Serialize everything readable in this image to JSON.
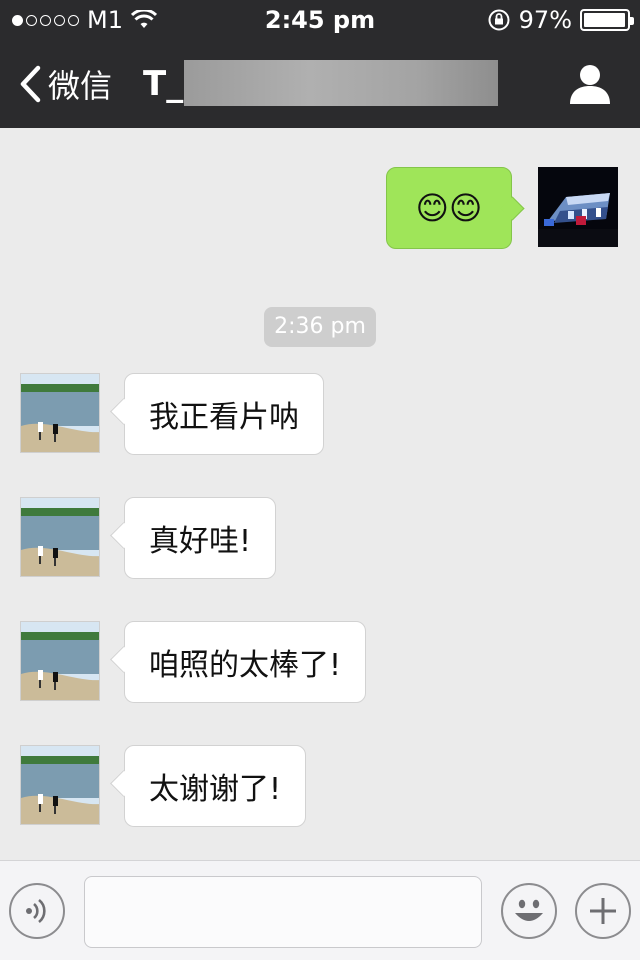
{
  "status_bar": {
    "carrier": "M1",
    "time": "2:45 pm",
    "battery_percent": "97%",
    "battery_level": 0.97,
    "signal_bars_filled": 1,
    "signal_bars_total": 5
  },
  "nav": {
    "back_label": "微信",
    "title": "T_"
  },
  "messages": [
    {
      "direction": "outgoing",
      "content": "😊😊"
    },
    {
      "direction": "incoming",
      "text": "我正看片呐"
    },
    {
      "direction": "incoming",
      "text": "真好哇!"
    },
    {
      "direction": "incoming",
      "text": "咱照的太棒了!"
    },
    {
      "direction": "incoming",
      "text": "太谢谢了!"
    }
  ],
  "timestamp": "2:36 pm",
  "input_bar": {
    "voice_icon": "voice-icon",
    "emoji_icon": "emoji-icon",
    "plus_icon": "plus-icon",
    "message_value": ""
  },
  "colors": {
    "nav_bg": "#2b2b2d",
    "chat_bg": "#ebebeb",
    "outgoing_bubble": "#9fe559",
    "incoming_bubble": "#ffffff"
  }
}
